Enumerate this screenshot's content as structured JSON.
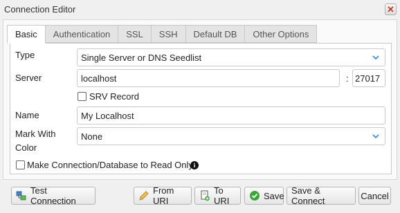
{
  "window": {
    "title": "Connection Editor"
  },
  "tabs": [
    {
      "label": "Basic"
    },
    {
      "label": "Authentication"
    },
    {
      "label": "SSL"
    },
    {
      "label": "SSH"
    },
    {
      "label": "Default DB"
    },
    {
      "label": "Other Options"
    }
  ],
  "form": {
    "type_label": "Type",
    "type_value": "Single Server or DNS Seedlist",
    "server_label": "Server",
    "server_value": "localhost",
    "port_separator": ":",
    "port_value": "27017",
    "srv_record_label": "SRV Record",
    "name_label": "Name",
    "name_value": "My Localhost",
    "mark_color_label_line1": "Mark With",
    "mark_color_label_line2": "Color",
    "mark_color_value": "None",
    "read_only_label": "Make Connection/Database to Read Only"
  },
  "buttons": {
    "test_connection": "Test Connection",
    "from_uri": "From URI",
    "to_uri": "To URI",
    "save": "Save",
    "save_connect": "Save & Connect",
    "cancel": "Cancel"
  },
  "colors": {
    "chevron": "#3a8fd8",
    "save_green": "#3aa63a",
    "close_red": "#c0392b"
  }
}
